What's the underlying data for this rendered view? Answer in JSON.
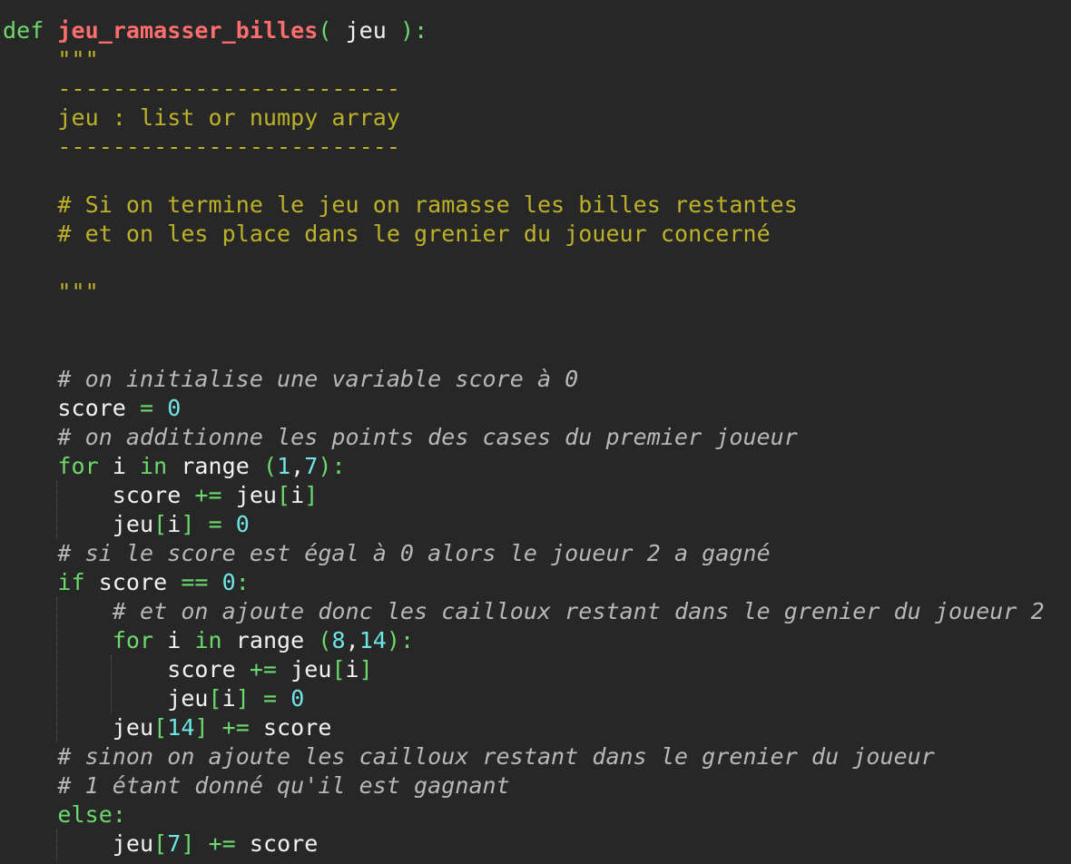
{
  "editor": {
    "theme_colors": {
      "background": "#272727",
      "keyword": "#6cd96c",
      "function_name": "#ff6d6d",
      "docstring": "#bdb129",
      "comment": "#b8b8b8",
      "number": "#6fe5e5",
      "bracket": "#6cd96c",
      "text": "#f2f2f2"
    },
    "lines": [
      {
        "segments": [
          {
            "text": "def",
            "type": "keyword"
          },
          {
            "text": " ",
            "type": "text"
          },
          {
            "text": "jeu_ramasser_billes",
            "type": "function_name"
          },
          {
            "text": "(",
            "type": "bracket"
          },
          {
            "text": " jeu ",
            "type": "text"
          },
          {
            "text": "):",
            "type": "bracket"
          }
        ]
      },
      {
        "segments": [
          {
            "text": "    \"\"\"",
            "type": "docstring"
          }
        ]
      },
      {
        "segments": [
          {
            "text": "    -------------------------",
            "type": "docstring"
          }
        ]
      },
      {
        "segments": [
          {
            "text": "    jeu : list or numpy array",
            "type": "docstring"
          }
        ]
      },
      {
        "segments": [
          {
            "text": "    -------------------------",
            "type": "docstring"
          }
        ]
      },
      {
        "segments": []
      },
      {
        "segments": [
          {
            "text": "    # Si on termine le jeu on ramasse les billes restantes",
            "type": "docstring"
          }
        ]
      },
      {
        "segments": [
          {
            "text": "    # et on les place dans le grenier du joueur concerné",
            "type": "docstring"
          }
        ]
      },
      {
        "segments": []
      },
      {
        "segments": [
          {
            "text": "    \"\"\"",
            "type": "docstring"
          }
        ]
      },
      {
        "segments": []
      },
      {
        "segments": []
      },
      {
        "segments": [
          {
            "text": "    # on initialise une variable score à 0",
            "type": "comment"
          }
        ]
      },
      {
        "segments": [
          {
            "text": "    score ",
            "type": "text"
          },
          {
            "text": "=",
            "type": "keyword"
          },
          {
            "text": " ",
            "type": "text"
          },
          {
            "text": "0",
            "type": "number"
          }
        ]
      },
      {
        "segments": [
          {
            "text": "    # on additionne les points des cases du premier joueur",
            "type": "comment"
          }
        ]
      },
      {
        "segments": [
          {
            "text": "    ",
            "type": "text"
          },
          {
            "text": "for",
            "type": "keyword"
          },
          {
            "text": " i ",
            "type": "text"
          },
          {
            "text": "in",
            "type": "keyword"
          },
          {
            "text": " range ",
            "type": "text"
          },
          {
            "text": "(",
            "type": "bracket"
          },
          {
            "text": "1",
            "type": "number"
          },
          {
            "text": ",",
            "type": "text"
          },
          {
            "text": "7",
            "type": "number"
          },
          {
            "text": "):",
            "type": "bracket"
          }
        ]
      },
      {
        "segments": [
          {
            "text": "        score ",
            "type": "text"
          },
          {
            "text": "+=",
            "type": "keyword"
          },
          {
            "text": " jeu",
            "type": "text"
          },
          {
            "text": "[",
            "type": "bracket"
          },
          {
            "text": "i",
            "type": "text"
          },
          {
            "text": "]",
            "type": "bracket"
          }
        ]
      },
      {
        "segments": [
          {
            "text": "        jeu",
            "type": "text"
          },
          {
            "text": "[",
            "type": "bracket"
          },
          {
            "text": "i",
            "type": "text"
          },
          {
            "text": "]",
            "type": "bracket"
          },
          {
            "text": " ",
            "type": "text"
          },
          {
            "text": "=",
            "type": "keyword"
          },
          {
            "text": " ",
            "type": "text"
          },
          {
            "text": "0",
            "type": "number"
          }
        ]
      },
      {
        "segments": [
          {
            "text": "    # si le score est égal à 0 alors le joueur 2 a gagné",
            "type": "comment"
          }
        ]
      },
      {
        "segments": [
          {
            "text": "    ",
            "type": "text"
          },
          {
            "text": "if",
            "type": "keyword"
          },
          {
            "text": " score ",
            "type": "text"
          },
          {
            "text": "==",
            "type": "keyword"
          },
          {
            "text": " ",
            "type": "text"
          },
          {
            "text": "0",
            "type": "number"
          },
          {
            "text": ":",
            "type": "bracket"
          }
        ]
      },
      {
        "segments": [
          {
            "text": "        # et on ajoute donc les cailloux restant dans le grenier du joueur 2",
            "type": "comment"
          }
        ]
      },
      {
        "segments": [
          {
            "text": "        ",
            "type": "text"
          },
          {
            "text": "for",
            "type": "keyword"
          },
          {
            "text": " i ",
            "type": "text"
          },
          {
            "text": "in",
            "type": "keyword"
          },
          {
            "text": " range ",
            "type": "text"
          },
          {
            "text": "(",
            "type": "bracket"
          },
          {
            "text": "8",
            "type": "number"
          },
          {
            "text": ",",
            "type": "text"
          },
          {
            "text": "14",
            "type": "number"
          },
          {
            "text": "):",
            "type": "bracket"
          }
        ]
      },
      {
        "segments": [
          {
            "text": "            score ",
            "type": "text"
          },
          {
            "text": "+=",
            "type": "keyword"
          },
          {
            "text": " jeu",
            "type": "text"
          },
          {
            "text": "[",
            "type": "bracket"
          },
          {
            "text": "i",
            "type": "text"
          },
          {
            "text": "]",
            "type": "bracket"
          }
        ]
      },
      {
        "segments": [
          {
            "text": "            jeu",
            "type": "text"
          },
          {
            "text": "[",
            "type": "bracket"
          },
          {
            "text": "i",
            "type": "text"
          },
          {
            "text": "]",
            "type": "bracket"
          },
          {
            "text": " ",
            "type": "text"
          },
          {
            "text": "=",
            "type": "keyword"
          },
          {
            "text": " ",
            "type": "text"
          },
          {
            "text": "0",
            "type": "number"
          }
        ]
      },
      {
        "segments": [
          {
            "text": "        jeu",
            "type": "text"
          },
          {
            "text": "[",
            "type": "bracket"
          },
          {
            "text": "14",
            "type": "number"
          },
          {
            "text": "]",
            "type": "bracket"
          },
          {
            "text": " ",
            "type": "text"
          },
          {
            "text": "+=",
            "type": "keyword"
          },
          {
            "text": " score",
            "type": "text"
          }
        ]
      },
      {
        "segments": [
          {
            "text": "    # sinon on ajoute les cailloux restant dans le grenier du joueur",
            "type": "comment"
          }
        ]
      },
      {
        "segments": [
          {
            "text": "    # 1 étant donné qu'il est gagnant",
            "type": "comment"
          }
        ]
      },
      {
        "segments": [
          {
            "text": "    ",
            "type": "text"
          },
          {
            "text": "else",
            "type": "keyword"
          },
          {
            "text": ":",
            "type": "bracket"
          }
        ]
      },
      {
        "segments": [
          {
            "text": "        jeu",
            "type": "text"
          },
          {
            "text": "[",
            "type": "bracket"
          },
          {
            "text": "7",
            "type": "number"
          },
          {
            "text": "]",
            "type": "bracket"
          },
          {
            "text": " ",
            "type": "text"
          },
          {
            "text": "+=",
            "type": "keyword"
          },
          {
            "text": " score",
            "type": "text"
          }
        ]
      }
    ]
  }
}
